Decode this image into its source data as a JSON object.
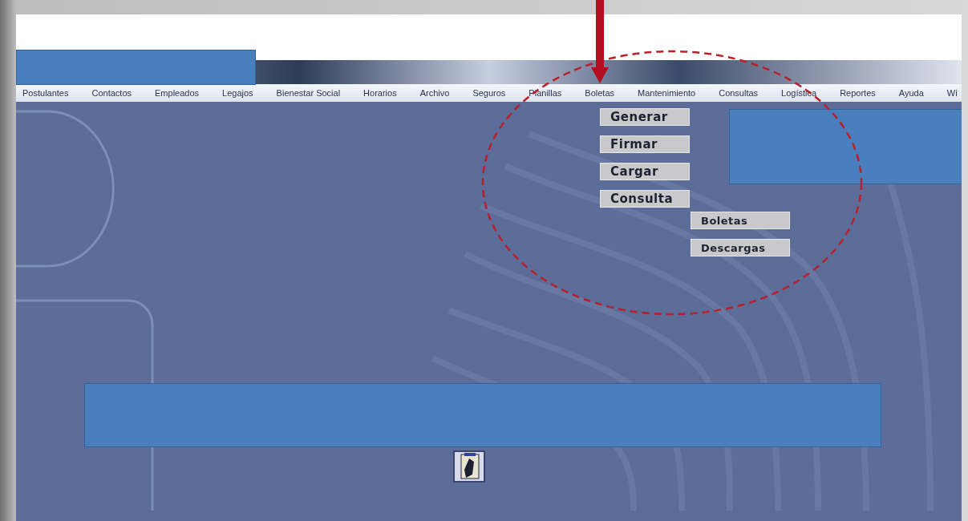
{
  "menu_bar": {
    "items": [
      {
        "label": "Postulantes"
      },
      {
        "label": "Contactos"
      },
      {
        "label": "Empleados"
      },
      {
        "label": "Legajos"
      },
      {
        "label": "Bienestar Social"
      },
      {
        "label": "Horarios"
      },
      {
        "label": "Archivo"
      },
      {
        "label": "Seguros"
      },
      {
        "label": "Planillas"
      },
      {
        "label": "Boletas"
      },
      {
        "label": "Mantenimiento"
      },
      {
        "label": "Consultas"
      },
      {
        "label": "Logística"
      },
      {
        "label": "Reportes"
      },
      {
        "label": "Ayuda"
      },
      {
        "label": "Wi"
      }
    ]
  },
  "boletas_menu": {
    "items": [
      {
        "label": "Generar"
      },
      {
        "label": "Firmar"
      },
      {
        "label": "Cargar"
      },
      {
        "label": "Consulta"
      }
    ]
  },
  "consulta_submenu": {
    "items": [
      {
        "label": "Boletas"
      },
      {
        "label": "Descargas"
      }
    ]
  }
}
